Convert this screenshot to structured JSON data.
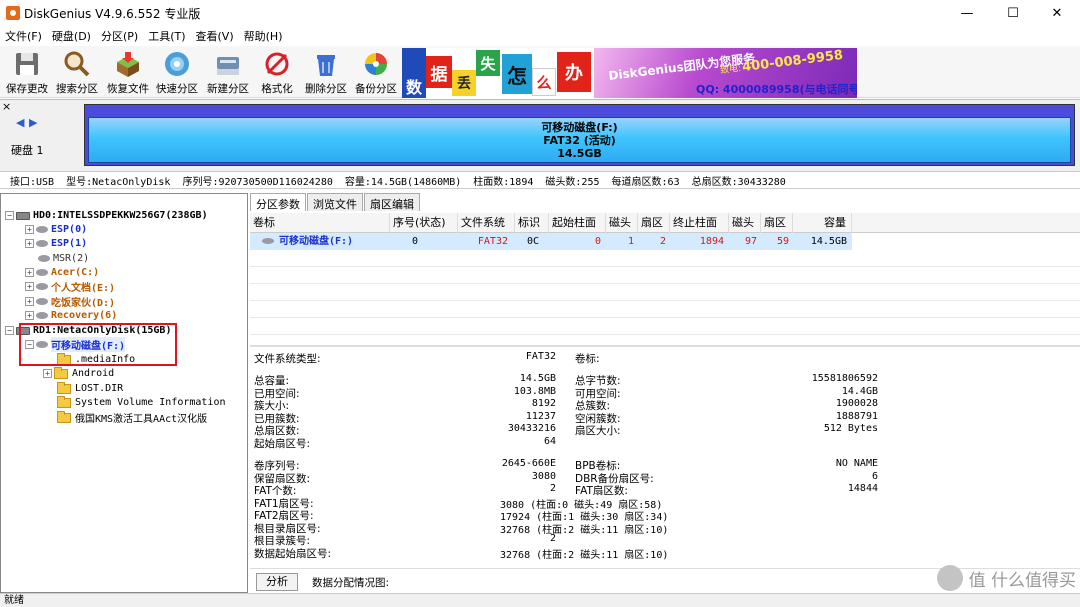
{
  "window": {
    "title": "DiskGenius V4.9.6.552 专业版",
    "minimize": "—",
    "maximize": "☐",
    "close": "✕"
  },
  "menu": [
    "文件(F)",
    "硬盘(D)",
    "分区(P)",
    "工具(T)",
    "查看(V)",
    "帮助(H)"
  ],
  "toolbar": [
    {
      "label": "保存更改",
      "icon": "floppy-icon"
    },
    {
      "label": "搜索分区",
      "icon": "magnifier-icon"
    },
    {
      "label": "恢复文件",
      "icon": "box-icon"
    },
    {
      "label": "快速分区",
      "icon": "disc-icon"
    },
    {
      "label": "新建分区",
      "icon": "new-partition-icon"
    },
    {
      "label": "格式化",
      "icon": "format-icon"
    },
    {
      "label": "删除分区",
      "icon": "trash-icon"
    },
    {
      "label": "备份分区",
      "icon": "backup-icon"
    }
  ],
  "banner": {
    "chars": [
      "数",
      "据",
      "丢",
      "失",
      "怎",
      "么",
      "办"
    ],
    "team": "DiskGenius团队为您服务",
    "phone": "400-008-9958",
    "qq": "QQ: 4000089958(与电话同号)",
    "phone_label": "致电:"
  },
  "diskmap": {
    "nav_prev": "◀",
    "nav_next": "▶",
    "disk_label": "硬盘 1",
    "close": "×",
    "partition_name": "可移动磁盘(F:)",
    "partition_fs": "FAT32 (活动)",
    "partition_size": "14.5GB"
  },
  "infoline": "接口:USB  型号:NetacOnlyDisk  序列号:920730500D116024280  容量:14.5GB(14860MB)  柱面数:1894  磁头数:255  每道扇区数:63  总扇区数:30433280",
  "tree": [
    {
      "label": "HD0:INTELSSDPEKKW256G7(238GB)",
      "type": "disk",
      "exp": "−",
      "color": "#000"
    },
    {
      "label": "ESP(0)",
      "type": "part",
      "exp": "+",
      "color": "#1530c8"
    },
    {
      "label": "ESP(1)",
      "type": "part",
      "exp": "+",
      "color": "#1530c8"
    },
    {
      "label": "MSR(2)",
      "type": "part",
      "exp": "",
      "color": "#333"
    },
    {
      "label": "Acer(C:)",
      "type": "part",
      "exp": "+",
      "color": "#b85a00"
    },
    {
      "label": "个人文档(E:)",
      "type": "part",
      "exp": "+",
      "color": "#b85a00"
    },
    {
      "label": "吃饭家伙(D:)",
      "type": "part",
      "exp": "+",
      "color": "#b85a00"
    },
    {
      "label": "Recovery(6)",
      "type": "part",
      "exp": "+",
      "color": "#b85a00"
    },
    {
      "label": "RD1:NetacOnlyDisk(15GB)",
      "type": "disk",
      "exp": "−",
      "color": "#000"
    },
    {
      "label": "可移动磁盘(F:)",
      "type": "part",
      "exp": "−",
      "color": "#1a30d0"
    },
    {
      "label": ".mediaInfo",
      "type": "folder",
      "exp": "",
      "color": "#000"
    },
    {
      "label": "Android",
      "type": "folder",
      "exp": "+",
      "color": "#000"
    },
    {
      "label": "LOST.DIR",
      "type": "folder",
      "exp": "",
      "color": "#000"
    },
    {
      "label": "System Volume Information",
      "type": "folder",
      "exp": "",
      "color": "#000"
    },
    {
      "label": "俄国KMS激活工具AAct汉化版",
      "type": "folder",
      "exp": "",
      "color": "#000"
    }
  ],
  "tabs": [
    "分区参数",
    "浏览文件",
    "扇区编辑"
  ],
  "grid": {
    "headers": [
      "卷标",
      "序号(状态)",
      "文件系统",
      "标识",
      "起始柱面",
      "磁头",
      "扇区",
      "终止柱面",
      "磁头",
      "扇区",
      "容量"
    ],
    "row": [
      "可移动磁盘(F:)",
      "0",
      "FAT32",
      "0C",
      "0",
      "1",
      "2",
      "1894",
      "97",
      "59",
      "14.5GB"
    ]
  },
  "details": {
    "fs_type_label": "文件系统类型:",
    "fs_type": "FAT32",
    "vol_label_label": "卷标:",
    "rows1": [
      {
        "l": "总容量:",
        "v": "14.5GB",
        "l2": "总字节数:",
        "v2": "15581806592"
      },
      {
        "l": "已用空间:",
        "v": "103.8MB",
        "l2": "可用空间:",
        "v2": "14.4GB"
      },
      {
        "l": "簇大小:",
        "v": "8192",
        "l2": "总簇数:",
        "v2": "1900028"
      },
      {
        "l": "已用簇数:",
        "v": "11237",
        "l2": "空闲簇数:",
        "v2": "1888791"
      },
      {
        "l": "总扇区数:",
        "v": "30433216",
        "l2": "扇区大小:",
        "v2": "512 Bytes"
      },
      {
        "l": "起始扇区号:",
        "v": "64",
        "l2": "",
        "v2": ""
      }
    ],
    "rows2": [
      {
        "l": "卷序列号:",
        "v": "2645-660E",
        "l2": "BPB卷标:",
        "v2": "NO NAME"
      },
      {
        "l": "保留扇区数:",
        "v": "3080",
        "l2": "DBR备份扇区号:",
        "v2": "6"
      },
      {
        "l": "FAT个数:",
        "v": "2",
        "l2": "FAT扇区数:",
        "v2": "14844"
      },
      {
        "l": "FAT1扇区号:",
        "v": "3080 (柱面:0 磁头:49 扇区:58)",
        "l2": "",
        "v2": ""
      },
      {
        "l": "FAT2扇区号:",
        "v": "17924 (柱面:1 磁头:30 扇区:34)",
        "l2": "",
        "v2": ""
      },
      {
        "l": "根目录扇区号:",
        "v": "32768 (柱面:2 磁头:11 扇区:10)",
        "l2": "",
        "v2": ""
      },
      {
        "l": "根目录簇号:",
        "v": "2",
        "l2": "",
        "v2": ""
      },
      {
        "l": "数据起始扇区号:",
        "v": "32768 (柱面:2 磁头:11 扇区:10)",
        "l2": "",
        "v2": ""
      }
    ],
    "analyze_button": "分析",
    "distribution_label": "数据分配情况图:"
  },
  "status": "就绪",
  "watermark": "值 什么值得买"
}
